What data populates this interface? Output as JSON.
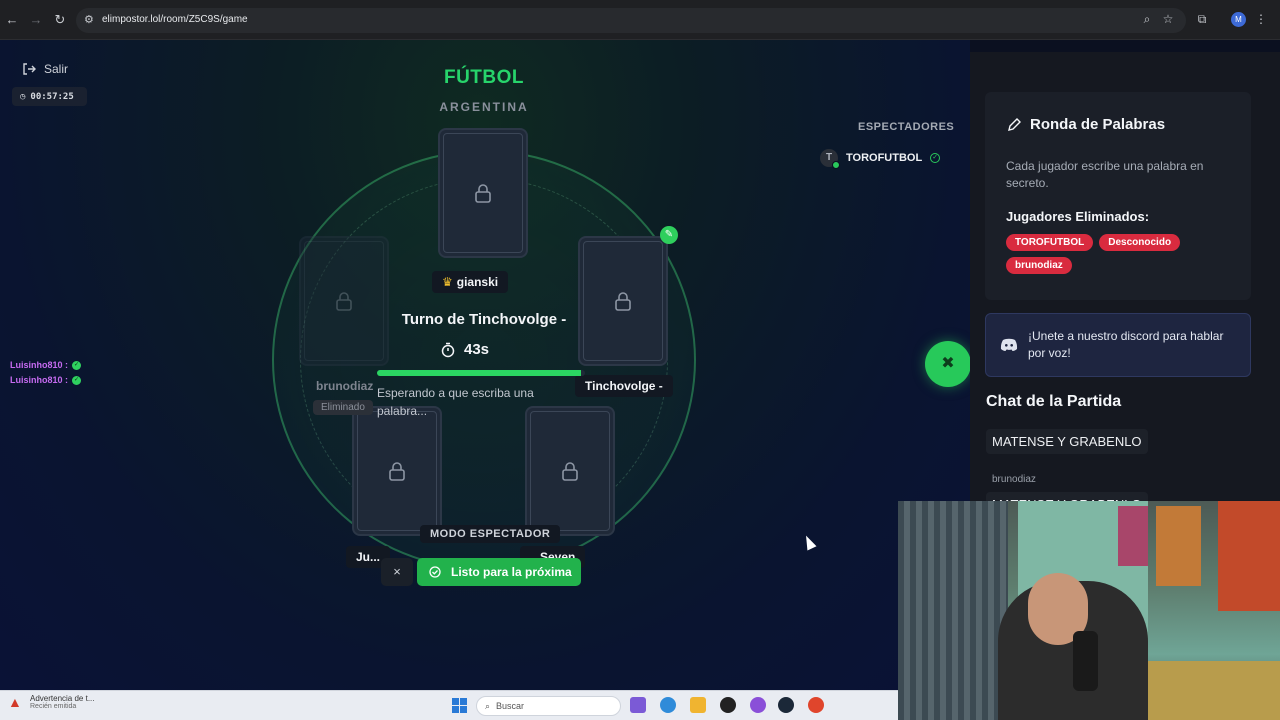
{
  "browser": {
    "url": "elimpostor.lol/room/Z5C9S/game",
    "profile_initial": "M"
  },
  "game": {
    "exit_label": "Salir",
    "elapsed_time": "00:57:25",
    "topic": "FÚTBOL",
    "category": "ARGENTINA",
    "turn_title": "Turno de Tinchovolge -",
    "turn_seconds": "43s",
    "turn_progress_fraction": 0.98,
    "waiting_text": "Esperando a que escriba una palabra...",
    "spectator_mode_label": "MODO ESPECTADOR",
    "ready_button_label": "Listo para la próxima",
    "close_symbol": "×",
    "players": {
      "top": "gianski",
      "left": "brunodiaz",
      "right": "Tinchovolge -",
      "bottom_left": "Ju...",
      "bottom_right": "...Seven"
    },
    "eliminated_badge": "Eliminado"
  },
  "spectators": {
    "title": "ESPECTADORES",
    "items": [
      {
        "initial": "T",
        "name": "TOROFUTBOL"
      }
    ]
  },
  "floating_chat": [
    {
      "name": "Luisinho810 :"
    },
    {
      "name": "Luisinho810 :"
    }
  ],
  "sidebar": {
    "round_title": "Ronda de Palabras",
    "round_desc": "Cada jugador escribe una palabra en secreto.",
    "eliminated_title": "Jugadores Eliminados:",
    "eliminated": [
      "TOROFUTBOL",
      "Desconocido",
      "brunodiaz"
    ],
    "discord_text": "¡Unete a nuestro discord para hablar por voz!",
    "chat_title": "Chat de la Partida",
    "chat_messages": [
      {
        "author": "",
        "text": "MATENSE Y GRABENLO"
      },
      {
        "author": "brunodiaz",
        "text": "MATENSE Y GRABENLO"
      }
    ]
  },
  "taskbar": {
    "notif_title": "Advertencia de t...",
    "notif_sub": "Recién emitida",
    "search_placeholder": "Buscar"
  },
  "colors": {
    "accent_green": "#27d46b",
    "danger_red": "#d92b3f",
    "discord_bg": "#1e2540"
  }
}
